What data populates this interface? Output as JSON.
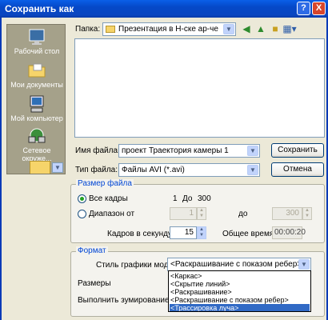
{
  "window": {
    "title": "Сохранить как",
    "help": "?",
    "close": "X"
  },
  "places": [
    {
      "label": "Рабочий стол",
      "icon": "desktop-icon"
    },
    {
      "label": "Мои документы",
      "icon": "folder-icon"
    },
    {
      "label": "Мой компьютер",
      "icon": "computer-icon"
    },
    {
      "label": "Сетевое окруже...",
      "icon": "network-icon"
    }
  ],
  "folder": {
    "label": "Папка:",
    "value": "Презентация в Н-ске ар-че"
  },
  "file_name": {
    "label": "Имя файла:",
    "value": "проект Траектория камеры 1"
  },
  "file_type": {
    "label": "Тип файла:",
    "value": "Файлы AVI (*.avi)"
  },
  "buttons": {
    "save": "Сохранить",
    "cancel": "Отмена"
  },
  "size_group": {
    "title": "Размер файла",
    "all_frames": "Все кадры",
    "all_from": "1",
    "all_to_label": "До",
    "all_to": "300",
    "range": "Диапазон от",
    "range_from": "1",
    "range_to_label": "до",
    "range_to": "300",
    "fps_label": "Кадров в секунду",
    "fps": "15",
    "total_label": "Общее время",
    "total": "00:00:20"
  },
  "format_group": {
    "title": "Формат",
    "style_label": "Стиль графики модели",
    "style_value": "<Раскрашивание с показом ребер>",
    "size_label": "Размеры",
    "zoom_label": "Выполнить зумирование"
  },
  "dropdown_items": [
    "<Каркас>",
    "<Скрытие линий>",
    "<Раскрашивание>",
    "<Раскрашивание с показом ребер>",
    "<Трассировка луча>"
  ],
  "selected_index": 4,
  "colors": {
    "titlebar": "#0A46C0",
    "group_title": "#0046D5",
    "selection": "#316AC5"
  }
}
